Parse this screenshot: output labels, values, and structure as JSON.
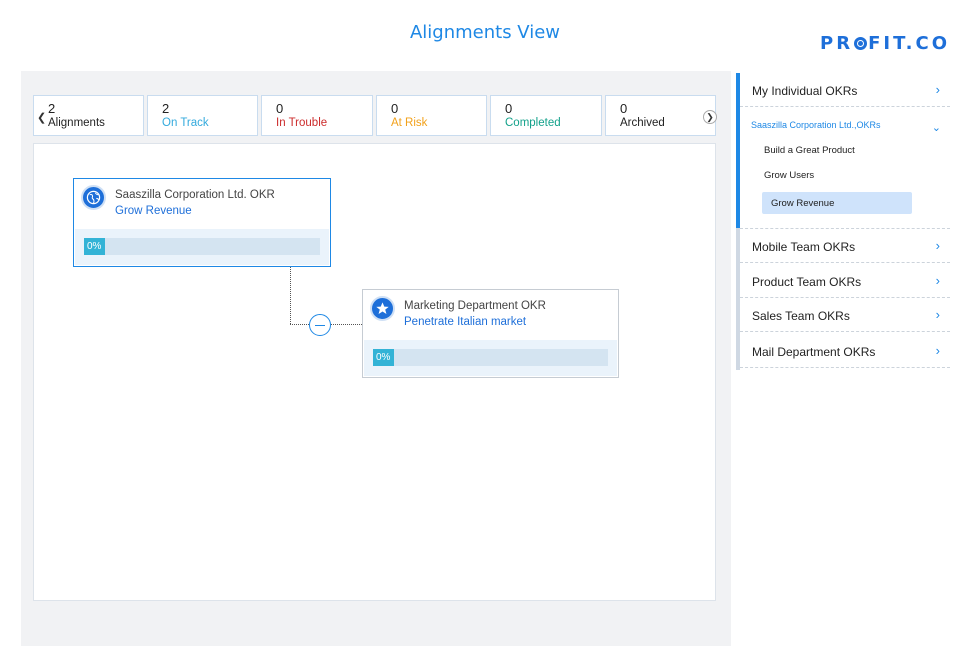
{
  "header": {
    "title": "Alignments View",
    "brand": {
      "pre": "PR",
      "post": "FIT.CO"
    }
  },
  "colors": {
    "accent": "#1e88e5",
    "on_track": "#33aadd",
    "in_trouble": "#cc2b2b",
    "at_risk": "#f2a11b",
    "completed": "#12a18a",
    "archived": "#222222"
  },
  "stats": [
    {
      "count": "2",
      "label": "Alignments",
      "color": "#222222"
    },
    {
      "count": "2",
      "label": "On Track",
      "color": "#33aadd"
    },
    {
      "count": "0",
      "label": "In Trouble",
      "color": "#cc2b2b"
    },
    {
      "count": "0",
      "label": "At Risk",
      "color": "#f2a11b"
    },
    {
      "count": "0",
      "label": "Completed",
      "color": "#12a18a"
    },
    {
      "count": "0",
      "label": "Archived",
      "color": "#222222"
    }
  ],
  "cards": [
    {
      "owner": "Saaszilla Corporation Ltd. OKR",
      "objective": "Grow Revenue",
      "progress": "0%",
      "icon": "globe-icon"
    },
    {
      "owner": "Marketing Department OKR",
      "objective": "Penetrate Italian market",
      "progress": "0%",
      "icon": "star-icon"
    }
  ],
  "sidebar": {
    "my_okrs": "My Individual OKRs",
    "group": {
      "title": "Saaszilla Corporation Ltd.,OKRs",
      "items": [
        "Build a Great Product",
        "Grow Users",
        "Grow Revenue"
      ],
      "active_index": 2
    },
    "teams": [
      "Mobile Team OKRs",
      "Product Team OKRs",
      "Sales Team OKRs",
      "Mail Department OKRs"
    ]
  }
}
